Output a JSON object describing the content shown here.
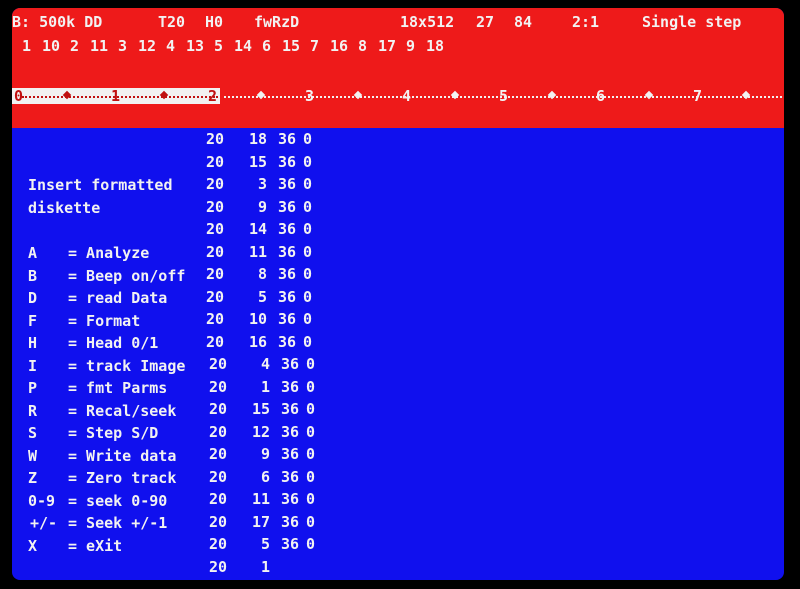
{
  "status": {
    "drive": "B: 500k DD",
    "track": "T20",
    "head": "H0",
    "flags": "fwRzD",
    "geometry": "18x512",
    "count_a": "27",
    "count_b": "84",
    "ratio": "2:1",
    "mode": "Single step"
  },
  "sector_order": [
    "1",
    "10",
    "2",
    "11",
    "3",
    "12",
    "4",
    "13",
    "5",
    "14",
    "6",
    "15",
    "7",
    "16",
    "8",
    "17",
    "9",
    "18"
  ],
  "ruler": {
    "numbers": [
      "0",
      "1",
      "2",
      "3",
      "4",
      "5",
      "6",
      "7"
    ],
    "highlight_fraction": 0.27
  },
  "menu": {
    "prompt_line1": "Insert formatted",
    "prompt_line2": "diskette",
    "commands": [
      {
        "key": "A  ",
        "desc": "= Analyze"
      },
      {
        "key": "B  ",
        "desc": "= Beep on/off"
      },
      {
        "key": "D  ",
        "desc": "= read Data"
      },
      {
        "key": "F  ",
        "desc": "= Format"
      },
      {
        "key": "H  ",
        "desc": "= Head 0/1"
      },
      {
        "key": "I  ",
        "desc": "= track Image"
      },
      {
        "key": "P  ",
        "desc": "= fmt Parms"
      },
      {
        "key": "R  ",
        "desc": "= Recal/seek"
      },
      {
        "key": "S  ",
        "desc": "= Step S/D"
      },
      {
        "key": "W  ",
        "desc": "= Write data"
      },
      {
        "key": "Z  ",
        "desc": "= Zero track"
      },
      {
        "key": "0-9",
        "desc": "= seek 0-90"
      },
      {
        "key": "+/-",
        "desc": "= Seek +/-1"
      },
      {
        "key": "X  ",
        "desc": "= eXit"
      }
    ]
  },
  "sector_table": [
    [
      "20",
      "18",
      "36",
      "0"
    ],
    [
      "20",
      "15",
      "36",
      "0"
    ],
    [
      "20",
      "3",
      "36",
      "0"
    ],
    [
      "20",
      "9",
      "36",
      "0"
    ],
    [
      "20",
      "14",
      "36",
      "0"
    ],
    [
      "20",
      "11",
      "36",
      "0"
    ],
    [
      "20",
      "8",
      "36",
      "0"
    ],
    [
      "20",
      "5",
      "36",
      "0"
    ],
    [
      "20",
      "10",
      "36",
      "0"
    ],
    [
      "20",
      "16",
      "36",
      "0"
    ],
    [
      "20",
      "4",
      "36",
      "0"
    ],
    [
      "20",
      "1",
      "36",
      "0"
    ],
    [
      "20",
      "15",
      "36",
      "0"
    ],
    [
      "20",
      "12",
      "36",
      "0"
    ],
    [
      "20",
      "9",
      "36",
      "0"
    ],
    [
      "20",
      "6",
      "36",
      "0"
    ],
    [
      "20",
      "11",
      "36",
      "0"
    ],
    [
      "20",
      "17",
      "36",
      "0"
    ],
    [
      "20",
      "5",
      "36",
      "0"
    ],
    [
      "20",
      "1",
      "",
      ""
    ]
  ],
  "colors": {
    "screen_background": "#1010ee",
    "header_background": "#ee1a1a",
    "text": "#f2f2f2",
    "ruler_highlight": "#f2f2f2"
  }
}
